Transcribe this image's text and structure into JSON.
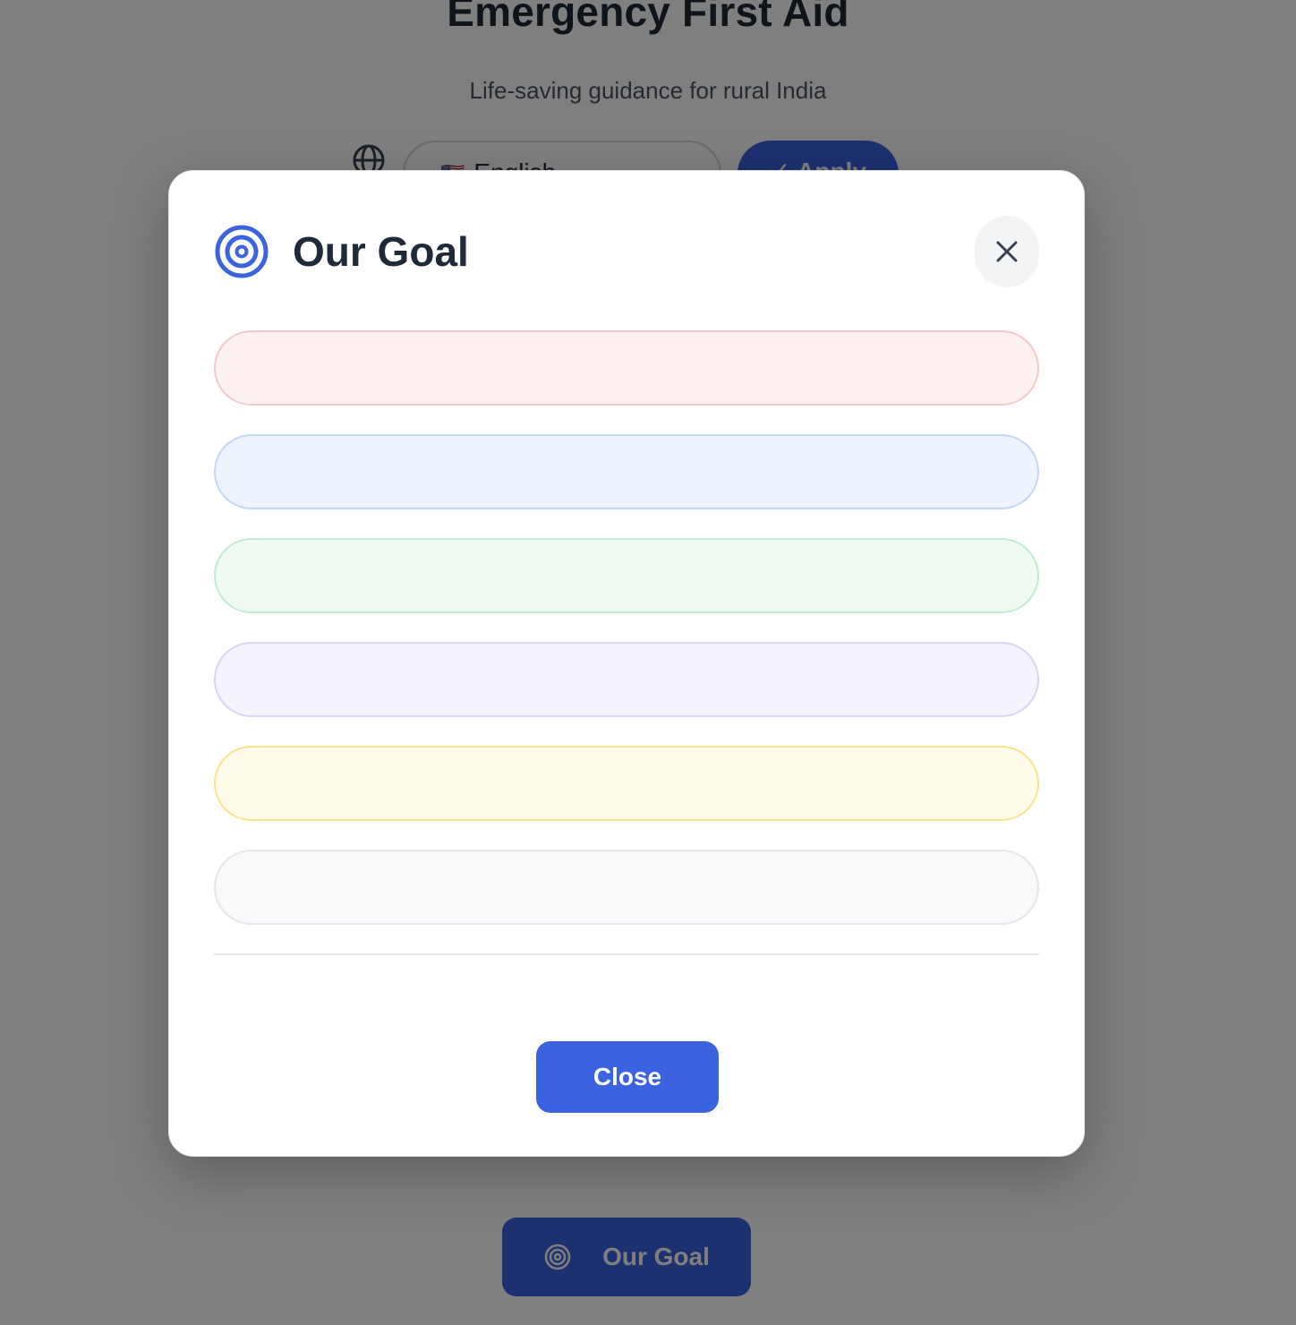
{
  "background": {
    "title": "Emergency First Aid",
    "subtitle": "Life-saving guidance for rural India",
    "language": {
      "flag": "🇺🇸",
      "selected": "English",
      "apply_label": "✓ Apply"
    },
    "goal_button_label": "Our Goal"
  },
  "modal": {
    "title": "Our Goal",
    "close_label": "Close",
    "items": [
      {
        "bg": "#fdf1f1",
        "border": "#f3c9c9"
      },
      {
        "bg": "#eef4fd",
        "border": "#c3d7f5"
      },
      {
        "bg": "#effbf2",
        "border": "#c2ecd0"
      },
      {
        "bg": "#f5f3fd",
        "border": "#dcd3f4"
      },
      {
        "bg": "#fefbe9",
        "border": "#f6e58e"
      },
      {
        "bg": "#f8f9fa",
        "border": "#e5e7eb"
      }
    ]
  },
  "colors": {
    "accent": "#3b63e0",
    "title_text": "#1f2937"
  }
}
